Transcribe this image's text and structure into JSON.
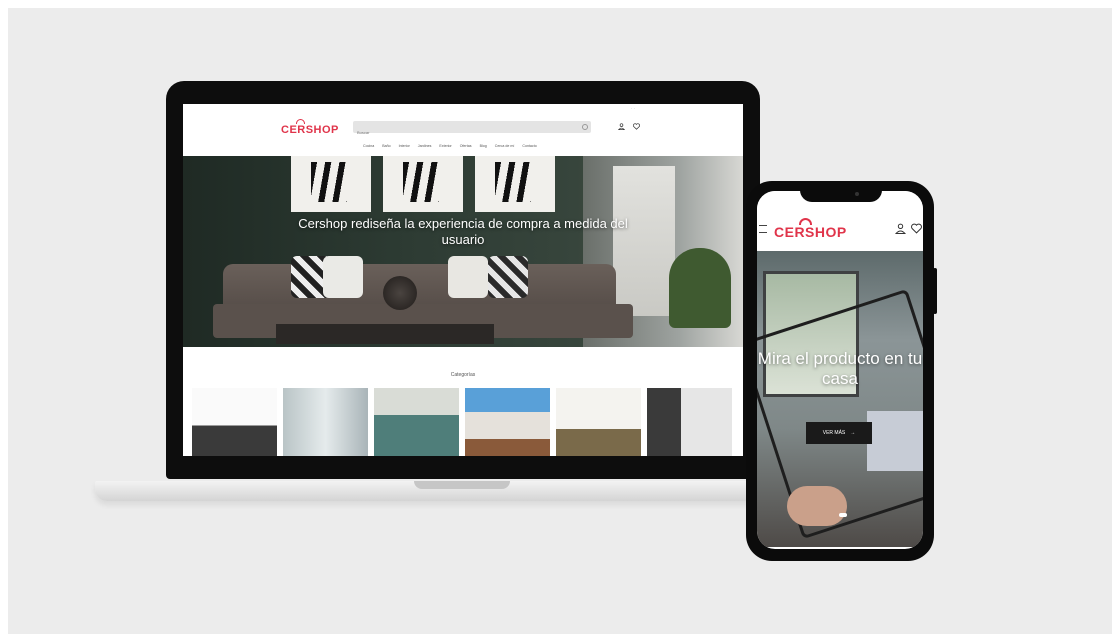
{
  "laptop_site": {
    "logo": "CERSHOP",
    "search": {
      "placeholder": "Buscar"
    },
    "top_mini": "· ·",
    "nav": [
      "Cocina",
      "Baño",
      "Interior",
      "Jardines",
      "Exterior",
      "Ofertas",
      "Blog",
      "Cerca de mí",
      "Contacto"
    ],
    "hero_title": "Cershop rediseña la experiencia de compra a medida del usuario",
    "categories_title": "Categorías"
  },
  "mobile_site": {
    "logo": "CERSHOP",
    "hero_title": "Mira el producto en tu casa",
    "cta_label": "VER MÁS",
    "cta_arrow": "→"
  },
  "colors": {
    "brand": "#e0344a",
    "background": "#ececec",
    "device": "#0d0d0d"
  },
  "icons": [
    "search-icon",
    "user-icon",
    "heart-icon",
    "menu-icon",
    "arrow-right-icon"
  ]
}
